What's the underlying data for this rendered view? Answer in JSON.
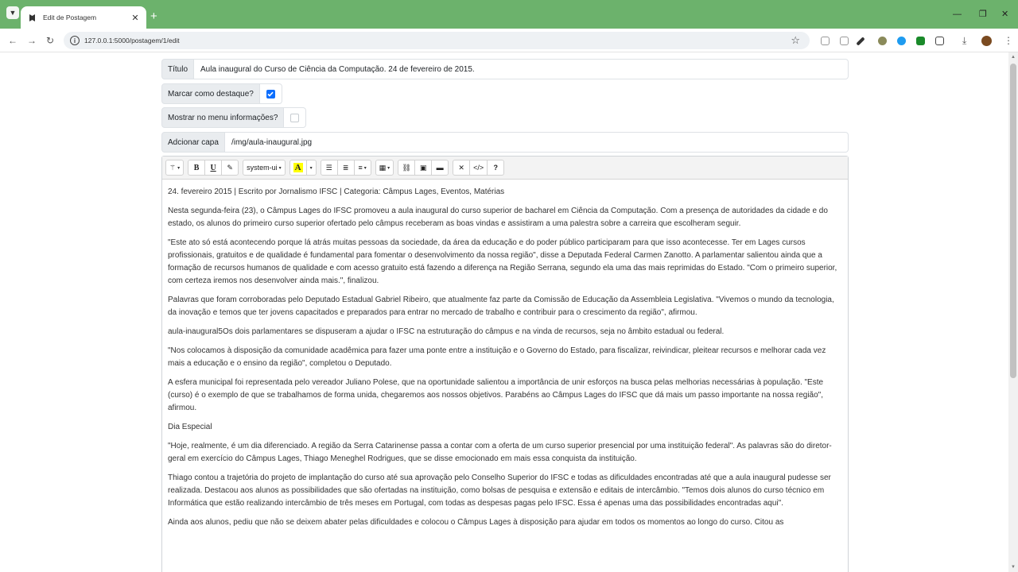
{
  "browser": {
    "tab_title": "Edit de Postagem",
    "url": "127.0.0.1:5000/postagem/1/edit"
  },
  "form": {
    "title_label": "Título",
    "title_value": "Aula inaugural do Curso de Ciência da Computação. 24 de fevereiro de 2015.",
    "featured_label": "Marcar como destaque?",
    "featured_checked": true,
    "menu_label": "Mostrar no menu informações?",
    "menu_checked": false,
    "cover_label": "Adcionar capa",
    "cover_value": "/img/aula-inaugural.jpg"
  },
  "toolbar": {
    "bold": "B",
    "underline": "U",
    "font_name": "system-ui",
    "color_letter": "A",
    "help": "?"
  },
  "content": {
    "paragraphs": [
      "24. fevereiro 2015 | Escrito por Jornalismo IFSC | Categoria: Câmpus Lages, Eventos, Matérias",
      "Nesta segunda-feira (23), o Câmpus Lages do IFSC promoveu a aula inaugural do curso superior de bacharel em Ciência da Computação. Com a presença de autoridades da cidade e do estado, os alunos do primeiro curso superior ofertado pelo câmpus receberam as boas vindas e assistiram a uma palestra sobre a carreira que escolheram seguir.",
      "\"Este ato só está acontecendo porque lá atrás muitas pessoas da sociedade, da área da educação e do poder público participaram para que isso acontecesse. Ter em Lages cursos profissionais, gratuitos e de qualidade é fundamental para fomentar o desenvolvimento da nossa região\", disse a Deputada Federal Carmen Zanotto. A parlamentar salientou ainda que a formação de recursos humanos de qualidade e com acesso gratuito está fazendo a diferença na Região Serrana, segundo ela uma das mais reprimidas do Estado. \"Com o primeiro superior, com certeza iremos nos desenvolver ainda mais.\", finalizou.",
      "Palavras que foram corroboradas pelo Deputado Estadual Gabriel Ribeiro, que atualmente faz parte da Comissão de Educação da Assembleia Legislativa. \"Vivemos o mundo da tecnologia, da inovação e temos que ter jovens capacitados e preparados para entrar no mercado de trabalho e contribuir para o crescimento da região\", afirmou.",
      "aula-inaugural5Os dois parlamentares se dispuseram a ajudar o IFSC na estruturação do câmpus e na vinda de recursos, seja no âmbito estadual ou federal.",
      "\"Nos colocamos à disposição da comunidade acadêmica para fazer uma ponte entre a instituição e o Governo do Estado, para fiscalizar, reivindicar, pleitear recursos e melhorar cada vez mais a educação e o ensino da região\", completou o Deputado.",
      "A esfera municipal foi representada pelo vereador Juliano Polese, que na oportunidade salientou a importância de unir esforços na busca pelas melhorias necessárias à população. \"Este (curso) é o exemplo de que se trabalhamos de forma unida, chegaremos aos nossos objetivos. Parabéns ao Câmpus Lages do IFSC que dá mais um passo importante na nossa região\", afirmou.",
      "Dia Especial",
      "\"Hoje, realmente, é um dia diferenciado. A região da Serra Catarinense passa a contar com a oferta de um curso superior presencial por uma instituição federal\". As palavras são do diretor-geral em exercício do Câmpus Lages, Thiago Meneghel Rodrigues, que se disse emocionado em mais essa conquista da instituição.",
      "Thiago contou a trajetória do projeto de implantação do curso até sua aprovação pelo Conselho Superior do IFSC e todas as dificuldades encontradas até que a aula inaugural pudesse ser realizada. Destacou aos alunos as possibilidades que são ofertadas na instituição, como bolsas de pesquisa e extensão e editais de intercâmbio. \"Temos dois alunos do curso técnico em Informática que estão realizando intercâmbio de três meses em Portugal, com todas as despesas pagas pelo IFSC. Essa é apenas uma das possibilidades encontradas aqui\".",
      "Ainda aos alunos, pediu que não se deixem abater pelas dificuldades e colocou o Câmpus Lages à disposição para ajudar em todos os momentos ao longo do curso. Citou as"
    ]
  },
  "colors": {
    "tab_strip": "#6cb26c",
    "checkbox_on": "#0d6efd",
    "highlight": "#ffff00"
  }
}
